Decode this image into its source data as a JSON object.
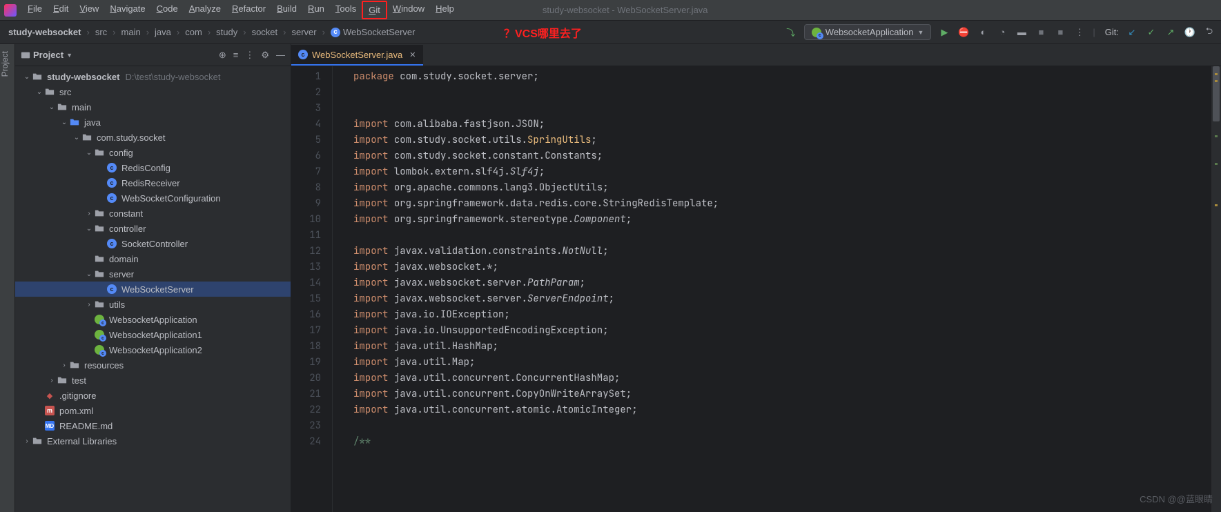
{
  "menubar": {
    "items": [
      "File",
      "Edit",
      "View",
      "Navigate",
      "Code",
      "Analyze",
      "Refactor",
      "Build",
      "Run",
      "Tools",
      "Git",
      "Window",
      "Help"
    ],
    "window_title": "study-websocket - WebSocketServer.java"
  },
  "annotation": "？VCS哪里去了",
  "breadcrumb": {
    "parts": [
      "study-websocket",
      "src",
      "main",
      "java",
      "com",
      "study",
      "socket",
      "server",
      "WebSocketServer"
    ]
  },
  "run_config": "WebsocketApplication",
  "git_label": "Git:",
  "project_panel": {
    "title": "Project",
    "root": {
      "label": "study-websocket",
      "path": "D:\\test\\study-websocket"
    }
  },
  "tree": [
    {
      "i": 0,
      "a": "d",
      "t": "root",
      "l": "study-websocket",
      "p": "D:\\test\\study-websocket"
    },
    {
      "i": 1,
      "a": "d",
      "t": "folder",
      "l": "src"
    },
    {
      "i": 2,
      "a": "d",
      "t": "folder",
      "l": "main"
    },
    {
      "i": 3,
      "a": "d",
      "t": "folder-blue",
      "l": "java"
    },
    {
      "i": 4,
      "a": "d",
      "t": "folder",
      "l": "com.study.socket"
    },
    {
      "i": 5,
      "a": "d",
      "t": "folder",
      "l": "config"
    },
    {
      "i": 6,
      "a": "",
      "t": "c",
      "l": "RedisConfig"
    },
    {
      "i": 6,
      "a": "",
      "t": "c",
      "l": "RedisReceiver"
    },
    {
      "i": 6,
      "a": "",
      "t": "c",
      "l": "WebSocketConfiguration"
    },
    {
      "i": 5,
      "a": "r",
      "t": "folder",
      "l": "constant"
    },
    {
      "i": 5,
      "a": "d",
      "t": "folder",
      "l": "controller"
    },
    {
      "i": 6,
      "a": "",
      "t": "c",
      "l": "SocketController"
    },
    {
      "i": 5,
      "a": "",
      "t": "folder",
      "l": "domain"
    },
    {
      "i": 5,
      "a": "d",
      "t": "folder",
      "l": "server"
    },
    {
      "i": 6,
      "a": "",
      "t": "c",
      "l": "WebSocketServer",
      "sel": true
    },
    {
      "i": 5,
      "a": "r",
      "t": "folder",
      "l": "utils"
    },
    {
      "i": 5,
      "a": "",
      "t": "spring",
      "l": "WebsocketApplication"
    },
    {
      "i": 5,
      "a": "",
      "t": "spring",
      "l": "WebsocketApplication1"
    },
    {
      "i": 5,
      "a": "",
      "t": "spring",
      "l": "WebsocketApplication2"
    },
    {
      "i": 3,
      "a": "r",
      "t": "folder",
      "l": "resources"
    },
    {
      "i": 2,
      "a": "r",
      "t": "folder",
      "l": "test"
    },
    {
      "i": 1,
      "a": "",
      "t": "gitignore",
      "l": ".gitignore"
    },
    {
      "i": 1,
      "a": "",
      "t": "maven",
      "l": "pom.xml"
    },
    {
      "i": 1,
      "a": "",
      "t": "md",
      "l": "README.md"
    },
    {
      "i": 0,
      "a": "r",
      "t": "lib",
      "l": "External Libraries"
    }
  ],
  "editor": {
    "tab": "WebSocketServer.java",
    "lines": [
      {
        "n": 1,
        "seg": [
          [
            "kw",
            "package "
          ],
          [
            "ident",
            "com.study.socket.server;"
          ]
        ]
      },
      {
        "n": 2,
        "seg": []
      },
      {
        "n": 3,
        "seg": []
      },
      {
        "n": 4,
        "seg": [
          [
            "kw",
            "import "
          ],
          [
            "ident",
            "com.alibaba.fastjson.JSON;"
          ]
        ]
      },
      {
        "n": 5,
        "seg": [
          [
            "kw",
            "import "
          ],
          [
            "ident",
            "com.study.socket.utils."
          ],
          [
            "hl-yellow",
            "SpringUtils"
          ],
          [
            "ident",
            ";"
          ]
        ]
      },
      {
        "n": 6,
        "seg": [
          [
            "kw",
            "import "
          ],
          [
            "ident",
            "com.study.socket.constant.Constants;"
          ]
        ]
      },
      {
        "n": 7,
        "seg": [
          [
            "kw",
            "import "
          ],
          [
            "ident",
            "lombok.extern.slf4j."
          ],
          [
            "anno2",
            "Slf4j"
          ],
          [
            "ident",
            ";"
          ]
        ]
      },
      {
        "n": 8,
        "seg": [
          [
            "kw",
            "import "
          ],
          [
            "ident",
            "org.apache.commons.lang3.ObjectUtils;"
          ]
        ]
      },
      {
        "n": 9,
        "seg": [
          [
            "kw",
            "import "
          ],
          [
            "ident",
            "org.springframework.data.redis.core.StringRedisTemplate;"
          ]
        ]
      },
      {
        "n": 10,
        "seg": [
          [
            "kw",
            "import "
          ],
          [
            "ident",
            "org.springframework.stereotype."
          ],
          [
            "anno2",
            "Component"
          ],
          [
            "ident",
            ";"
          ]
        ]
      },
      {
        "n": 11,
        "seg": []
      },
      {
        "n": 12,
        "seg": [
          [
            "kw",
            "import "
          ],
          [
            "ident",
            "javax.validation.constraints."
          ],
          [
            "anno2",
            "NotNull"
          ],
          [
            "ident",
            ";"
          ]
        ]
      },
      {
        "n": 13,
        "seg": [
          [
            "kw",
            "import "
          ],
          [
            "ident",
            "javax.websocket.*;"
          ]
        ]
      },
      {
        "n": 14,
        "seg": [
          [
            "kw",
            "import "
          ],
          [
            "ident",
            "javax.websocket.server."
          ],
          [
            "anno2",
            "PathParam"
          ],
          [
            "ident",
            ";"
          ]
        ]
      },
      {
        "n": 15,
        "seg": [
          [
            "kw",
            "import "
          ],
          [
            "ident",
            "javax.websocket.server."
          ],
          [
            "anno2",
            "ServerEndpoint"
          ],
          [
            "ident",
            ";"
          ]
        ]
      },
      {
        "n": 16,
        "seg": [
          [
            "kw",
            "import "
          ],
          [
            "ident",
            "java.io.IOException;"
          ]
        ]
      },
      {
        "n": 17,
        "seg": [
          [
            "kw",
            "import "
          ],
          [
            "ident",
            "java.io.UnsupportedEncodingException;"
          ]
        ]
      },
      {
        "n": 18,
        "seg": [
          [
            "kw",
            "import "
          ],
          [
            "ident",
            "java.util.HashMap;"
          ]
        ]
      },
      {
        "n": 19,
        "seg": [
          [
            "kw",
            "import "
          ],
          [
            "ident",
            "java.util.Map;"
          ]
        ]
      },
      {
        "n": 20,
        "seg": [
          [
            "kw",
            "import "
          ],
          [
            "ident",
            "java.util.concurrent.ConcurrentHashMap;"
          ]
        ]
      },
      {
        "n": 21,
        "seg": [
          [
            "kw",
            "import "
          ],
          [
            "ident",
            "java.util.concurrent.CopyOnWriteArraySet;"
          ]
        ]
      },
      {
        "n": 22,
        "seg": [
          [
            "kw",
            "import "
          ],
          [
            "ident",
            "java.util.concurrent.atomic.AtomicInteger;"
          ]
        ]
      },
      {
        "n": 23,
        "seg": []
      },
      {
        "n": 24,
        "seg": [
          [
            "comment",
            "/**"
          ]
        ]
      }
    ]
  },
  "watermark": "CSDN @@蓝眼睛"
}
